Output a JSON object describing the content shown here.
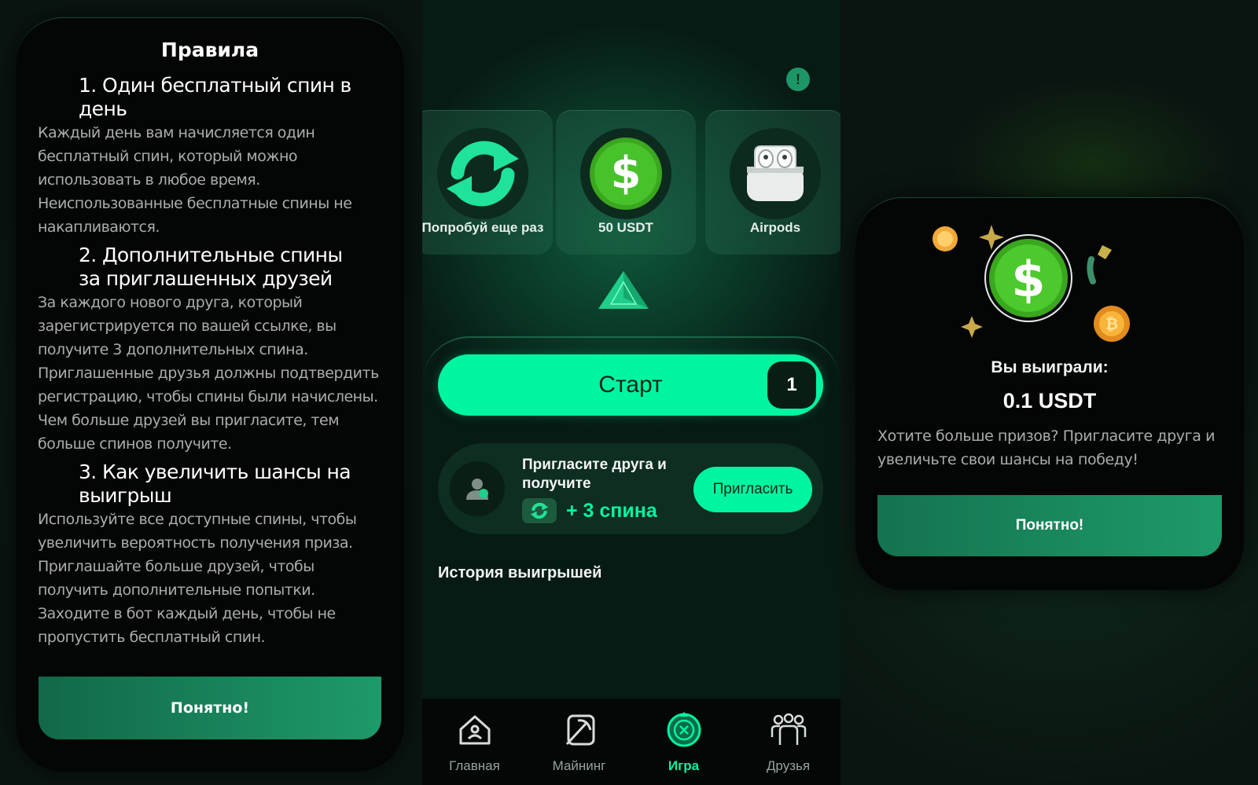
{
  "rules": {
    "title": "Правила",
    "sections": [
      {
        "heading": "1. Один бесплатный спин в день",
        "body": "Каждый день вам начисляется один бесплатный спин, который можно использовать в любое время. Неиспользованные бесплатные спины не накапливаются."
      },
      {
        "heading": "2. Дополнительные спины за приглашенных друзей",
        "body": "За каждого нового друга, который зарегистрируется по вашей ссылке, вы получите 3 дополнительных спина. Приглашенные друзья должны подтвердить регистрацию, чтобы спины были начислены. Чем больше друзей вы пригласите, тем больше спинов получите."
      },
      {
        "heading": "3. Как увеличить шансы на выигрыш",
        "body": "Используйте все доступные спины, чтобы увеличить вероятность получения приза. Приглашайте больше друзей, чтобы получить дополнительные попытки. Заходите в бот каждый день, чтобы не пропустить бесплатный спин."
      }
    ],
    "ok_label": "Понятно!"
  },
  "game": {
    "info_label": "!",
    "prizes": [
      {
        "label": "Попробуй еще раз",
        "icon": "refresh-icon"
      },
      {
        "label": "50 USDT",
        "icon": "dollar-coin-icon"
      },
      {
        "label": "Airpods",
        "icon": "airpods-icon"
      }
    ],
    "start": {
      "label": "Старт",
      "count": "1"
    },
    "invite": {
      "text": "Пригласите друга и получите",
      "bonus": "+ 3 спина",
      "button": "Пригласить"
    },
    "history_title": "История выигрышей",
    "nav": [
      {
        "label": "Главная",
        "icon": "home-icon"
      },
      {
        "label": "Майнинг",
        "icon": "pickaxe-icon"
      },
      {
        "label": "Игра",
        "icon": "game-wheel-icon",
        "active": true
      },
      {
        "label": "Друзья",
        "icon": "friends-icon"
      }
    ],
    "colors": {
      "accent": "#00f5a0",
      "background": "#061511"
    }
  },
  "win": {
    "label": "Вы выиграли:",
    "amount": "0.1 USDT",
    "description": "Хотите больше призов? Пригласите друга и увеличьте свои шансы на победу!",
    "ok_label": "Понятно!"
  }
}
